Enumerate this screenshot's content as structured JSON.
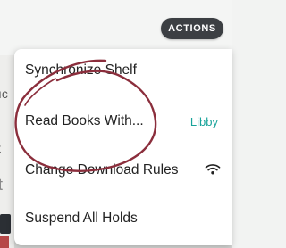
{
  "header": {
    "actions_label": "ACTIONS"
  },
  "background": {
    "partial_text_1": "ıc",
    "partial_text_2": "t",
    "partial_text_3": "t"
  },
  "menu": {
    "items": [
      {
        "label": "Synchronize Shelf",
        "value": ""
      },
      {
        "label": "Read Books With...",
        "value": "Libby"
      },
      {
        "label": "Change Download Rules",
        "value": "",
        "icon": "wifi-icon"
      },
      {
        "label": "Suspend All Holds",
        "value": ""
      }
    ]
  },
  "colors": {
    "actions_button": "#3c3f43",
    "accent_value": "#18a39a",
    "annotation_stroke": "#8b2e3c"
  }
}
